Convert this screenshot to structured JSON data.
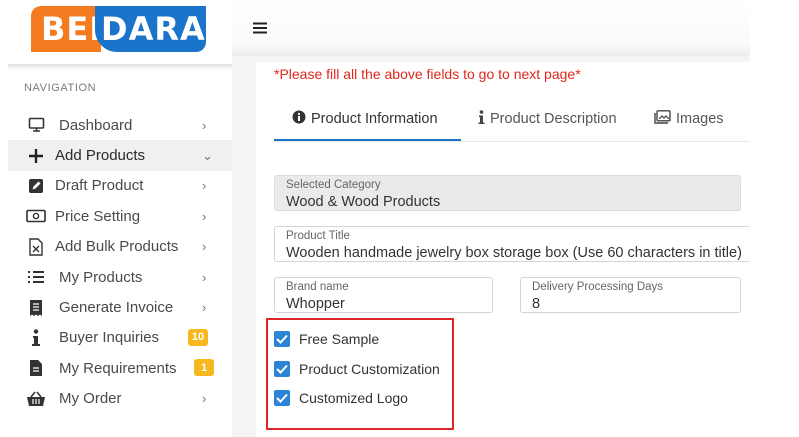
{
  "brand": {
    "logo_part1": "BEL",
    "logo_part2": "DARA",
    "orange": "#f47b20",
    "blue": "#1a74c9"
  },
  "sidebar": {
    "heading": "NAVIGATION",
    "items": [
      {
        "label": "Dashboard",
        "icon": "monitor-icon",
        "trail": "›"
      },
      {
        "label": "Add Products",
        "icon": "plus-icon",
        "trail": "⌄"
      },
      {
        "label": "Draft Product",
        "icon": "edit-icon",
        "trail": "›"
      },
      {
        "label": "Price Setting",
        "icon": "money-icon",
        "trail": "›"
      },
      {
        "label": "Add Bulk Products",
        "icon": "excel-file-icon",
        "trail": "›"
      },
      {
        "label": "My Products",
        "icon": "list-icon",
        "trail": "›"
      },
      {
        "label": "Generate Invoice",
        "icon": "invoice-icon",
        "trail": "›"
      },
      {
        "label": "Buyer Inquiries",
        "icon": "info-icon",
        "badge": "10"
      },
      {
        "label": "My Requirements",
        "icon": "document-icon",
        "badge": "1"
      },
      {
        "label": "My Order",
        "icon": "basket-icon",
        "trail": "›"
      }
    ]
  },
  "header": {
    "menu_icon": "hamburger-icon"
  },
  "form": {
    "warning": "*Please fill all the above fields to go to next page*",
    "tabs": [
      {
        "label": "Product Information",
        "icon": "info-circle-icon"
      },
      {
        "label": "Product Description",
        "icon": "info-icon"
      },
      {
        "label": "Images",
        "icon": "images-icon"
      }
    ],
    "selected_category": {
      "label": "Selected Category",
      "value": "Wood & Wood Products"
    },
    "product_title": {
      "label": "Product Title",
      "value": "Wooden handmade jewelry box storage box (Use 60 characters in title)"
    },
    "brand_name": {
      "label": "Brand name",
      "value": "Whopper"
    },
    "delivery_days": {
      "label": "Delivery Processing Days",
      "value": "8"
    },
    "checkboxes": [
      {
        "label": "Free Sample",
        "checked": true
      },
      {
        "label": "Product Customization",
        "checked": true
      },
      {
        "label": "Customized Logo",
        "checked": true
      }
    ]
  }
}
